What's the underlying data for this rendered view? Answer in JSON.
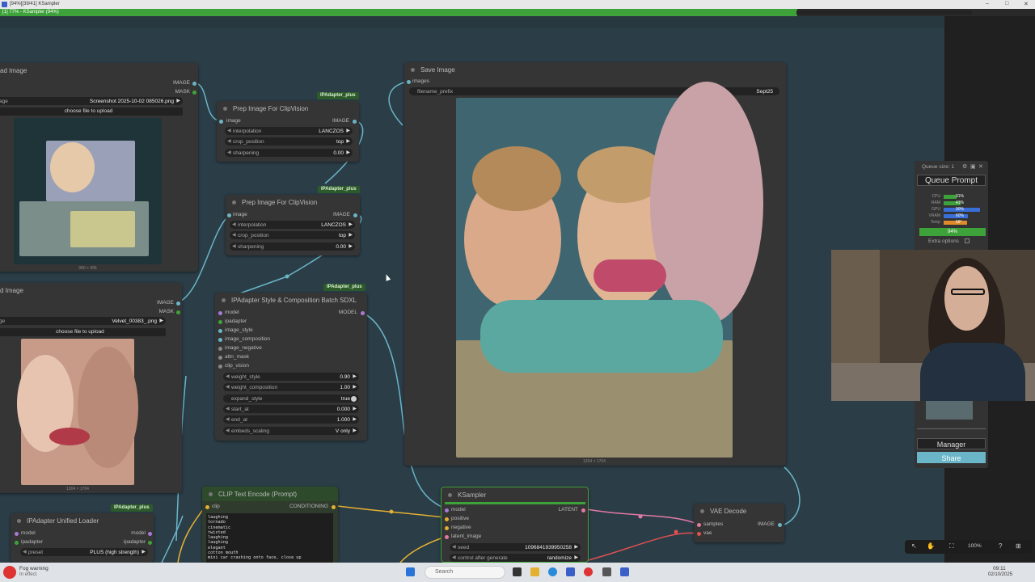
{
  "window": {
    "title": "[94%][39/41] KSampler",
    "progress_label": "[1] 77% - KSampler (94%)",
    "progress_pct": 77
  },
  "nodes": {
    "load_image_1": {
      "title": "ad Image",
      "outputs": [
        "IMAGE",
        "MASK"
      ],
      "image_label": "age",
      "image_value": "Screenshot 2025-10-02 085026.png",
      "upload_label": "choose file to upload",
      "dims": "980 × 995"
    },
    "load_image_2": {
      "title": "d Image",
      "outputs": [
        "IMAGE",
        "MASK"
      ],
      "image_label": "ge",
      "image_value": "Velvet_00383_.png",
      "upload_label": "choose file to upload",
      "dims": "1304 × 1704"
    },
    "prep_1": {
      "tag": "IPAdapter_plus",
      "title": "Prep Image For ClipVision",
      "input": "image",
      "output": "IMAGE",
      "widgets": [
        {
          "label": "interpolation",
          "value": "LANCZOS"
        },
        {
          "label": "crop_position",
          "value": "top"
        },
        {
          "label": "sharpening",
          "value": "0.00"
        }
      ]
    },
    "prep_2": {
      "tag": "IPAdapter_plus",
      "title": "Prep Image For ClipVision",
      "input": "image",
      "output": "IMAGE",
      "widgets": [
        {
          "label": "interpolation",
          "value": "LANCZOS"
        },
        {
          "label": "crop_position",
          "value": "top"
        },
        {
          "label": "sharpening",
          "value": "0.00"
        }
      ]
    },
    "ipadapter_style": {
      "tag": "IPAdapter_plus",
      "title": "IPAdapter Style & Composition Batch SDXL",
      "inputs": [
        "model",
        "ipadapter",
        "image_style",
        "image_composition",
        "image_negative",
        "attn_mask",
        "clip_vision"
      ],
      "output": "MODEL",
      "widgets": [
        {
          "label": "weight_style",
          "value": "0.90"
        },
        {
          "label": "weight_composition",
          "value": "1.00"
        },
        {
          "label": "expand_style",
          "value": "true"
        },
        {
          "label": "start_at",
          "value": "0.000"
        },
        {
          "label": "end_at",
          "value": "1.000"
        },
        {
          "label": "embeds_scaling",
          "value": "V only"
        }
      ]
    },
    "save_image": {
      "title": "Save Image",
      "input": "images",
      "prefix_label": "filename_prefix",
      "prefix_value": "Sept25",
      "dims": "1304 × 1704"
    },
    "unified_loader": {
      "tag": "IPAdapter_plus",
      "title": "IPAdapter Unified Loader",
      "inputs": [
        "model",
        "ipadapter"
      ],
      "outputs": [
        "model",
        "ipadapter"
      ],
      "preset_label": "preset",
      "preset_value": "PLUS (high strength)"
    },
    "clip_text": {
      "title": "CLIP Text Encode (Prompt)",
      "input": "clip",
      "output": "CONDITIONING",
      "text_lines": [
        "laughing",
        "tornado",
        "cinematic",
        "twisted",
        "laughing",
        "laughing",
        "elegant",
        "cotton mouth",
        "mini car crashing onto face, close up"
      ]
    },
    "ksampler": {
      "title": "KSampler",
      "inputs": [
        "model",
        "positive",
        "negative",
        "latent_image"
      ],
      "output": "LATENT",
      "widgets": [
        {
          "label": "seed",
          "value": "1096841939950258"
        },
        {
          "label": "control after generate",
          "value": "randomize"
        }
      ]
    },
    "vae_decode": {
      "title": "VAE Decode",
      "inputs": [
        "samples",
        "vae"
      ],
      "output": "IMAGE"
    }
  },
  "queue_panel": {
    "queue_size": "Queue size: 1",
    "queue_button": "Queue Prompt",
    "stats": [
      {
        "label": "CPU",
        "value": "31%",
        "color": "#3ea23a"
      },
      {
        "label": "RAM",
        "value": "41%",
        "color": "#3ea23a"
      },
      {
        "label": "GPU",
        "value": "90%",
        "color": "#3a6fd8"
      },
      {
        "label": "VRAM",
        "value": "60%",
        "color": "#3a6fd8"
      },
      {
        "label": "Temp",
        "value": "58°",
        "color": "#e08a2a"
      }
    ],
    "progress": "94%",
    "extra_options": "Extra options",
    "manager_button": "Manager",
    "share_button": "Share"
  },
  "zoom": "100%",
  "taskbar": {
    "weather": "Fog warning",
    "weather_sub": "In effect",
    "search_placeholder": "Search",
    "time": "09:11",
    "date": "02/10/2025"
  },
  "colors": {
    "board": "#2b3d47",
    "node": "#353535",
    "tag_green": "#2d5a2a",
    "ksampler_border": "#3ea23a",
    "share": "#6ab5c8"
  }
}
